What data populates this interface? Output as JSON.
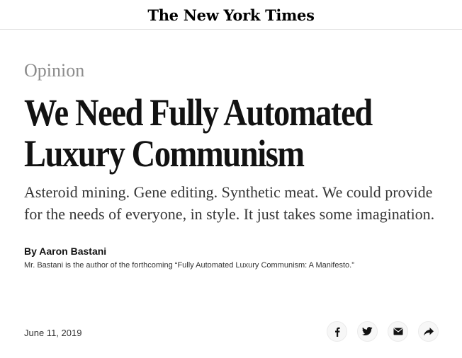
{
  "masthead": {
    "logo_text": "The New York Times"
  },
  "article": {
    "section": "Opinion",
    "headline": "We Need Fully Automated Luxury Communism",
    "summary": "Asteroid mining. Gene editing. Synthetic meat. We could provide for the needs of everyone, in style. It just takes some imagination.",
    "byline_prefix": "By",
    "author": "Aaron Bastani",
    "author_bio": "Mr. Bastani is the author of the forthcoming “Fully Automated Luxury Communism: A Manifesto.”",
    "date": "June 11, 2019"
  },
  "share": {
    "buttons": [
      {
        "icon": "facebook-icon"
      },
      {
        "icon": "twitter-icon"
      },
      {
        "icon": "email-icon"
      },
      {
        "icon": "share-arrow-icon"
      }
    ]
  },
  "colors": {
    "text": "#121212",
    "section_label": "#8c8c8c",
    "rule": "#e2e2e2",
    "share_button_bg": "#f7f7f7"
  }
}
